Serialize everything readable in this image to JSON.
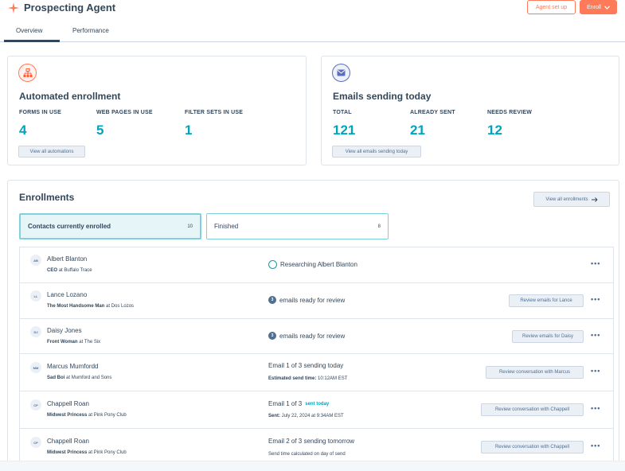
{
  "header": {
    "app_title": "Prospecting Agent",
    "agent_setup_label": "Agent set up",
    "enroll_label": "Enroll",
    "brand_color": "#ff7a59"
  },
  "tabs": [
    {
      "label": "Overview",
      "active": true
    },
    {
      "label": "Performance",
      "active": false
    }
  ],
  "automated": {
    "title": "Automated enrollment",
    "icon": "org-chart-icon",
    "stats": [
      {
        "label": "FORMS IN USE",
        "value": "4"
      },
      {
        "label": "WEB PAGES IN USE",
        "value": "5"
      },
      {
        "label": "FILTER SETS IN USE",
        "value": "1"
      }
    ],
    "button_label": "View all automations"
  },
  "emails": {
    "title": "Emails sending today",
    "icon": "envelope-icon",
    "stats": [
      {
        "label": "TOTAL",
        "value": "121"
      },
      {
        "label": "ALREADY SENT",
        "value": "21"
      },
      {
        "label": "NEEDS REVIEW",
        "value": "12"
      }
    ],
    "button_label": "View all emails sending today"
  },
  "enrollments": {
    "title": "Enrollments",
    "view_all_label": "View all enrollments",
    "segments": [
      {
        "label": "Contacts currently enrolled",
        "count": "10",
        "active": true
      },
      {
        "label": "Finished",
        "count": "8",
        "active": false
      }
    ],
    "rows": [
      {
        "initials": "AB",
        "name": "Albert Blanton",
        "title": "CEO",
        "company_prefix": "at",
        "company": "Buffalo Trace",
        "status": "Researching Albert Blanton",
        "status_icon": "circle-outline-icon"
      },
      {
        "initials": "LL",
        "name": "Lance Lozano",
        "title": "The Most Handsome Man",
        "company_prefix": "at",
        "company": "Dos Lozos",
        "status_count": "3",
        "status": "emails ready for review",
        "action": "Review emails for Lance"
      },
      {
        "initials": "DJ",
        "name": "Daisy Jones",
        "title": "Front Woman",
        "company_prefix": "at",
        "company": "The Six",
        "status_count": "3",
        "status": "emails ready for review",
        "action": "Review emails for Daisy"
      },
      {
        "initials": "MM",
        "name": "Marcus Mumfordd",
        "title": "Sad Boi",
        "company_prefix": "at",
        "company": "Mumford and Sons",
        "status": "Email 1 of 3 sending today",
        "detail_label": "Estimated send time:",
        "detail_value": "10:12AM EST",
        "action": "Review conversation with Marcus"
      },
      {
        "initials": "CP",
        "name": "Chappell Roan",
        "title": "Midwest Princess",
        "company_prefix": "at",
        "company": "Pink Pony Club",
        "status": "Email 1 of 3",
        "status_accent": "sent today",
        "detail_label": "Sent:",
        "detail_value": "July 22, 2024 at 9:34AM EST",
        "action": "Review conversation with Chappell"
      },
      {
        "initials": "CP",
        "name": "Chappell Roan",
        "title": "Midwest Princess",
        "company_prefix": "at",
        "company": "Pink Pony Club",
        "status": "Email 2 of 3 sending tomorrow",
        "detail_plain": "Send time calculated on day of send",
        "action": "Review conversation with Chappell"
      }
    ],
    "more_label": "•••"
  }
}
